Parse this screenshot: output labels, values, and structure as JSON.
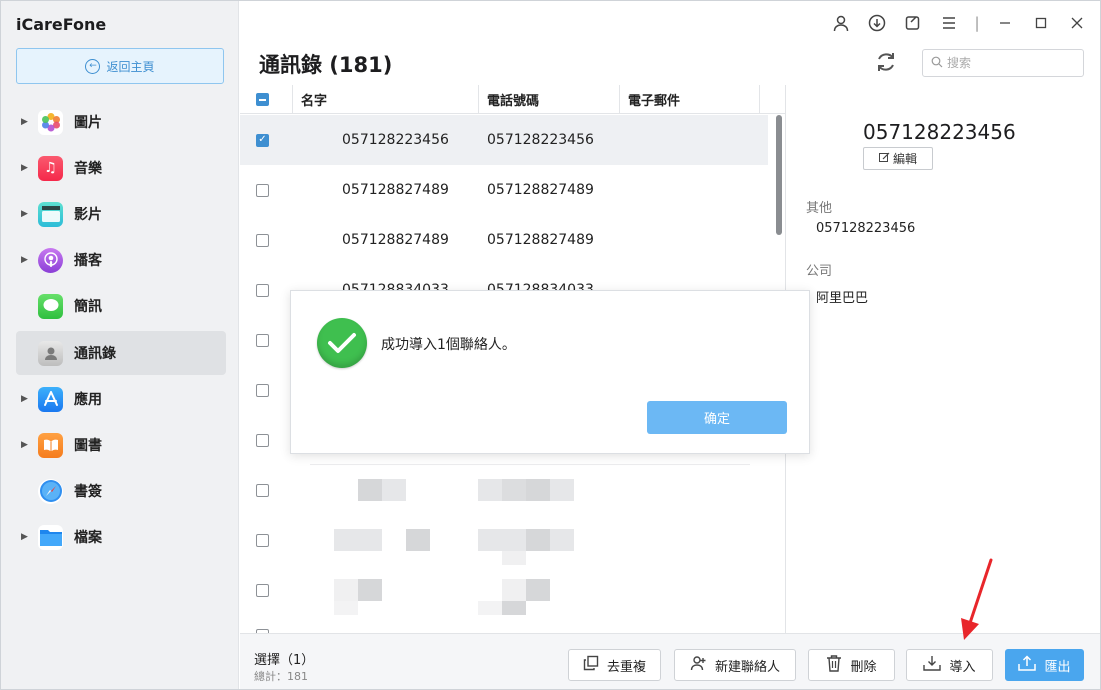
{
  "app": {
    "title": "iCareFone"
  },
  "sidebar": {
    "back_label": "返回主頁",
    "items": [
      {
        "label": "圖片",
        "icon": "photos-icon",
        "has_caret": true
      },
      {
        "label": "音樂",
        "icon": "music-icon",
        "has_caret": true
      },
      {
        "label": "影片",
        "icon": "video-icon",
        "has_caret": true
      },
      {
        "label": "播客",
        "icon": "podcast-icon",
        "has_caret": true
      },
      {
        "label": "簡訊",
        "icon": "messages-icon",
        "has_caret": false
      },
      {
        "label": "通訊錄",
        "icon": "contacts-icon",
        "has_caret": false,
        "active": true
      },
      {
        "label": "應用",
        "icon": "appstore-icon",
        "has_caret": true
      },
      {
        "label": "圖書",
        "icon": "books-icon",
        "has_caret": true
      },
      {
        "label": "書簽",
        "icon": "safari-icon",
        "has_caret": false
      },
      {
        "label": "檔案",
        "icon": "files-icon",
        "has_caret": true
      }
    ]
  },
  "header": {
    "title": "通訊錄 (181)",
    "search_placeholder": "搜索"
  },
  "table": {
    "columns": [
      "名字",
      "電話號碼",
      "電子郵件"
    ],
    "rows": [
      {
        "name": "057128223456",
        "phone": "057128223456",
        "checked": true
      },
      {
        "name": "057128827489",
        "phone": "057128827489",
        "checked": false
      },
      {
        "name": "057128827489",
        "phone": "057128827489",
        "checked": false
      },
      {
        "name": "057128834033",
        "phone": "057128834033",
        "checked": false
      }
    ]
  },
  "detail": {
    "name": "057128223456",
    "edit_label": "編輯",
    "other_label": "其他",
    "other_value": "057128223456",
    "company_label": "公司",
    "company_value": "阿里巴巴"
  },
  "footer": {
    "selected": "選擇（1）",
    "total": "總計：181",
    "buttons": {
      "dedupe": "去重複",
      "new_contact": "新建聯絡人",
      "delete": "刪除",
      "import": "導入",
      "export": "匯出"
    }
  },
  "dialog": {
    "message": "成功導入1個聯絡人。",
    "ok_label": "确定"
  },
  "colors": {
    "accent": "#3e8fd1",
    "primary_button": "#4aa6ee",
    "dialog_button": "#6cb8f4",
    "success": "#3fbf4f",
    "arrow": "#e8262b"
  }
}
